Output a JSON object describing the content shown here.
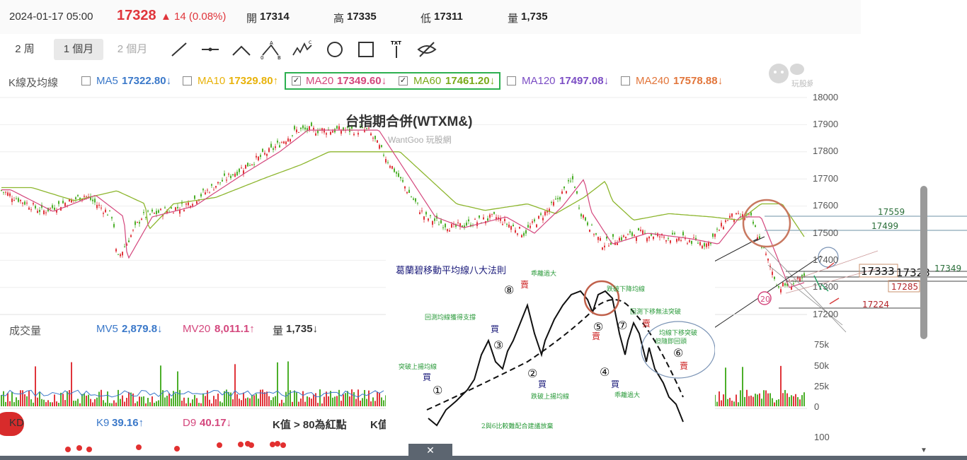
{
  "header": {
    "datetime": "2024-01-17 05:00",
    "price": "17328",
    "change": "▲ 14 (0.08%)",
    "open_label": "開",
    "open": "17314",
    "high_label": "高",
    "high": "17335",
    "low_label": "低",
    "low": "17311",
    "vol_label": "量",
    "vol": "1,735",
    "up_color": "#e0353b"
  },
  "periods": [
    "2 周",
    "1 個月",
    "2 個月"
  ],
  "ma_row": {
    "label": "K線及均線",
    "items": [
      {
        "name": "MA5",
        "value": "17322.80↓",
        "checked": false,
        "color": "#3a78c9"
      },
      {
        "name": "MA10",
        "value": "17329.80↑",
        "checked": false,
        "color": "#e8b20a"
      },
      {
        "name": "MA20",
        "value": "17349.60↓",
        "checked": true,
        "color": "#d4477d"
      },
      {
        "name": "MA60",
        "value": "17461.20↓",
        "checked": true,
        "color": "#7aaa1a"
      },
      {
        "name": "MA120",
        "value": "17497.08↓",
        "checked": false,
        "color": "#7b4dc4"
      },
      {
        "name": "MA240",
        "value": "17578.88↓",
        "checked": false,
        "color": "#e2753a"
      }
    ]
  },
  "chart": {
    "title": "台指期合併(WTXM&)",
    "watermark": "WantGoo 玩股網",
    "logo_text": "玩股網",
    "y_ticks": [
      "18000",
      "17900",
      "17800",
      "17700",
      "17600",
      "17500",
      "17400",
      "17300",
      "17200"
    ],
    "levels": [
      "17559",
      "17499",
      "17349",
      "17333",
      "17328",
      "17285",
      "17224"
    ],
    "ma20_badge": "20"
  },
  "granville": {
    "title": "葛蘭碧移動平均線八大法則",
    "rules_text": [
      "突破上揚均線",
      "回測均線獲得支撐",
      "乖離過大",
      "跌破上揚均線",
      "跌破下降均線",
      "回測下移無法突破",
      "均線下移突破",
      "但隨即回頭",
      "乖離過大",
      "2與6比較難配合建議放棄"
    ],
    "buy": "買",
    "sell": "賣",
    "numbers": [
      "①",
      "②",
      "③",
      "④",
      "⑤",
      "⑥",
      "⑦",
      "⑧"
    ]
  },
  "volume": {
    "label": "成交量",
    "mv5_label": "MV5",
    "mv5": "2,879.8↓",
    "mv20_label": "MV20",
    "mv20": "8,011.1↑",
    "qty_label": "量",
    "qty": "1,735↓",
    "ticks": [
      "75k",
      "50k",
      "25k",
      "0"
    ]
  },
  "kd": {
    "label": "KD",
    "k_label": "K9",
    "k": "39.16↑",
    "d_label": "D9",
    "d": "40.17↓",
    "note": "K值 > 80為紅點",
    "note2": "K值",
    "tick": "100"
  }
}
